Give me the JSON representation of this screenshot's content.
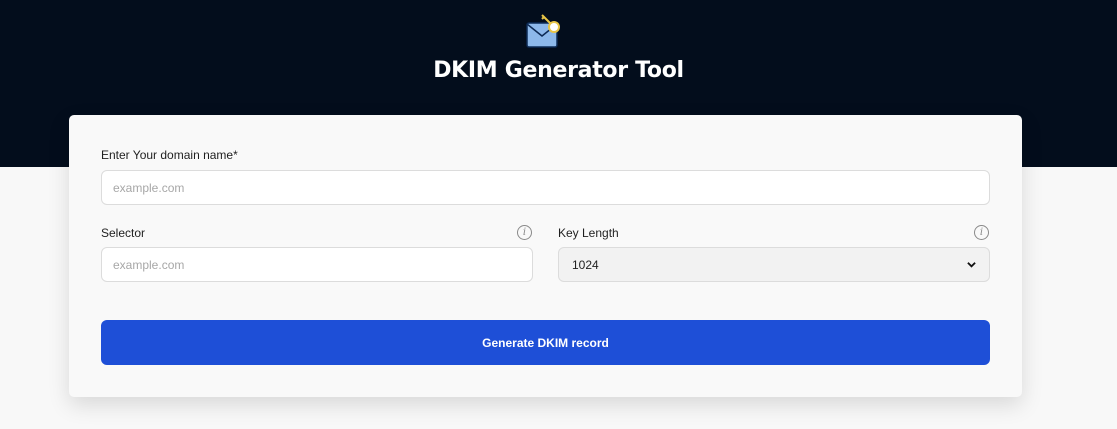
{
  "header": {
    "logo_icon": "envelope-key-icon",
    "title": "DKIM Generator Tool"
  },
  "form": {
    "domain": {
      "label": "Enter Your domain name*",
      "placeholder": "example.com",
      "value": ""
    },
    "selector": {
      "label": "Selector",
      "placeholder": "example.com",
      "value": "",
      "info_icon": "info-icon"
    },
    "key_length": {
      "label": "Key Length",
      "selected": "1024",
      "info_icon": "info-icon"
    },
    "submit_label": "Generate DKIM record"
  },
  "colors": {
    "header_bg": "#030d1c",
    "page_bg": "#f8f8f8",
    "primary_button": "#1e4fd7"
  }
}
